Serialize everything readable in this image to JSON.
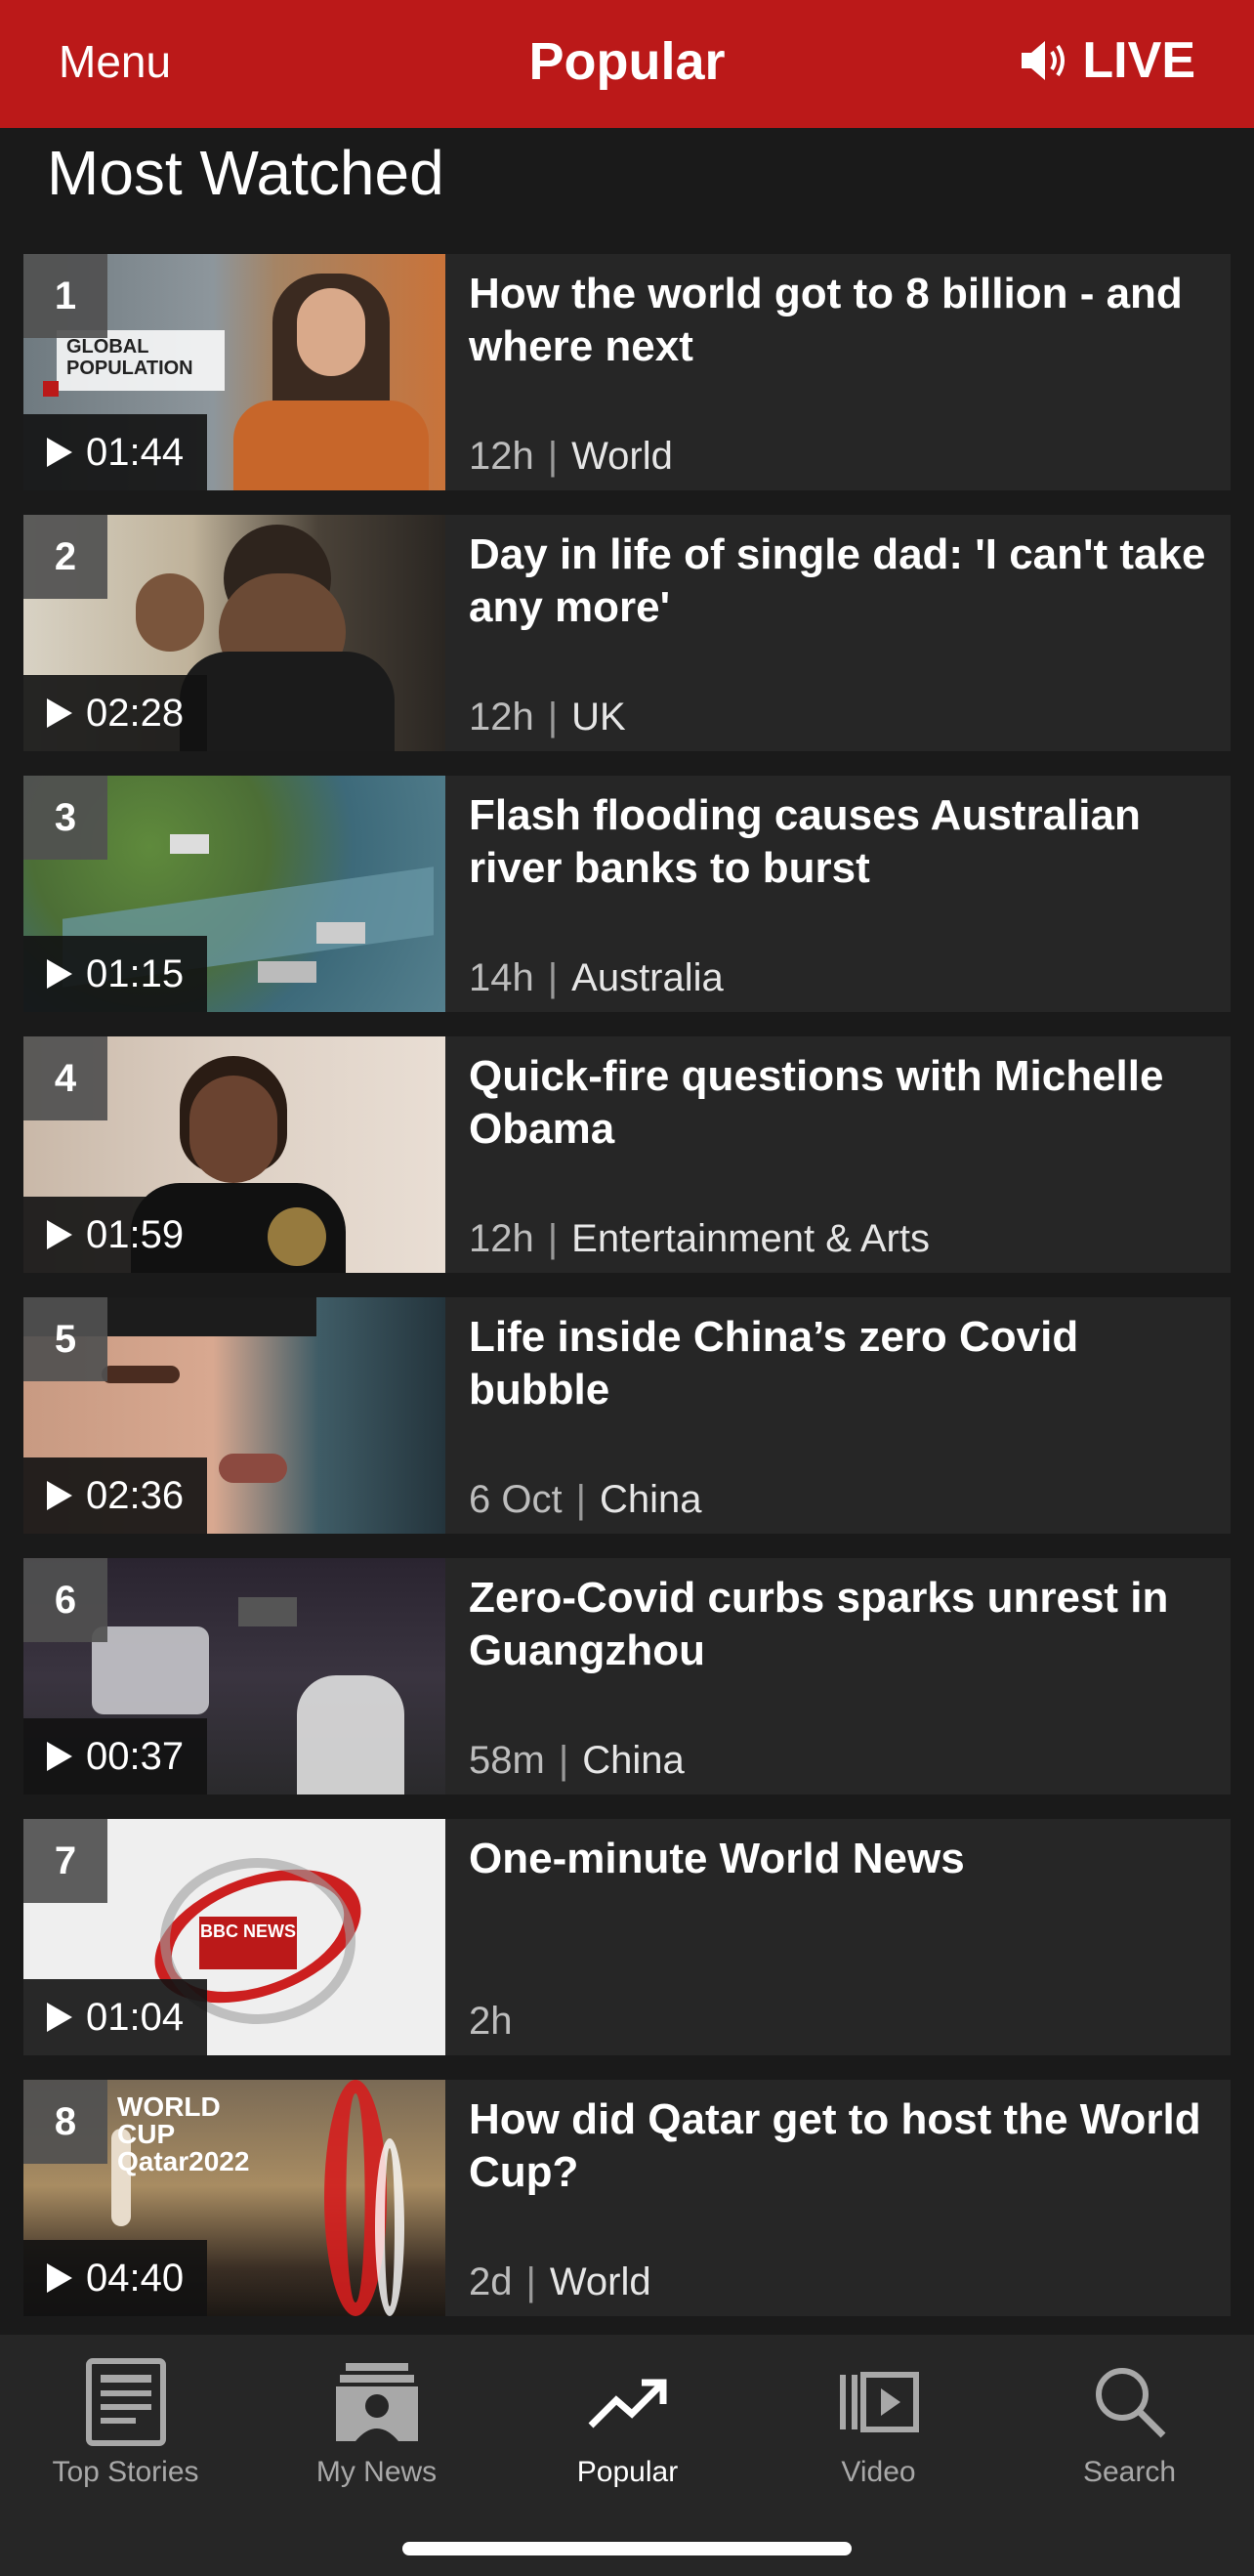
{
  "header": {
    "menu_label": "Menu",
    "title": "Popular",
    "live_label": "LIVE"
  },
  "section": {
    "title": "Most Watched"
  },
  "items": [
    {
      "rank": "1",
      "duration": "01:44",
      "headline": "How the world got to 8 billion - and where next",
      "age": "12h",
      "category": "World",
      "thumb_caption": "GLOBAL POPULATION"
    },
    {
      "rank": "2",
      "duration": "02:28",
      "headline": "Day in life of single dad: 'I can't take any more'",
      "age": "12h",
      "category": "UK"
    },
    {
      "rank": "3",
      "duration": "01:15",
      "headline": "Flash flooding causes Australian river banks to burst",
      "age": "14h",
      "category": "Australia"
    },
    {
      "rank": "4",
      "duration": "01:59",
      "headline": "Quick-fire questions with Michelle Obama",
      "age": "12h",
      "category": "Entertainment & Arts"
    },
    {
      "rank": "5",
      "duration": "02:36",
      "headline": "Life inside China’s zero Covid bubble",
      "age": "6 Oct",
      "category": "China"
    },
    {
      "rank": "6",
      "duration": "00:37",
      "headline": "Zero-Covid curbs sparks unrest in Guangzhou",
      "age": "58m",
      "category": "China"
    },
    {
      "rank": "7",
      "duration": "01:04",
      "headline": "One-minute World News",
      "age": "2h",
      "category": "",
      "thumb_caption": "BBC NEWS"
    },
    {
      "rank": "8",
      "duration": "04:40",
      "headline": "How did Qatar get to host the World Cup?",
      "age": "2d",
      "category": "World",
      "thumb_caption": "WORLD CUP Qatar2022"
    }
  ],
  "tabs": [
    {
      "label": "Top Stories",
      "icon": "newspaper-icon"
    },
    {
      "label": "My News",
      "icon": "my-news-icon"
    },
    {
      "label": "Popular",
      "icon": "trending-icon",
      "active": true
    },
    {
      "label": "Video",
      "icon": "video-icon"
    },
    {
      "label": "Search",
      "icon": "search-icon"
    }
  ],
  "colors": {
    "brand": "#bb1919",
    "background": "#1a1a1a",
    "card": "#262626"
  }
}
